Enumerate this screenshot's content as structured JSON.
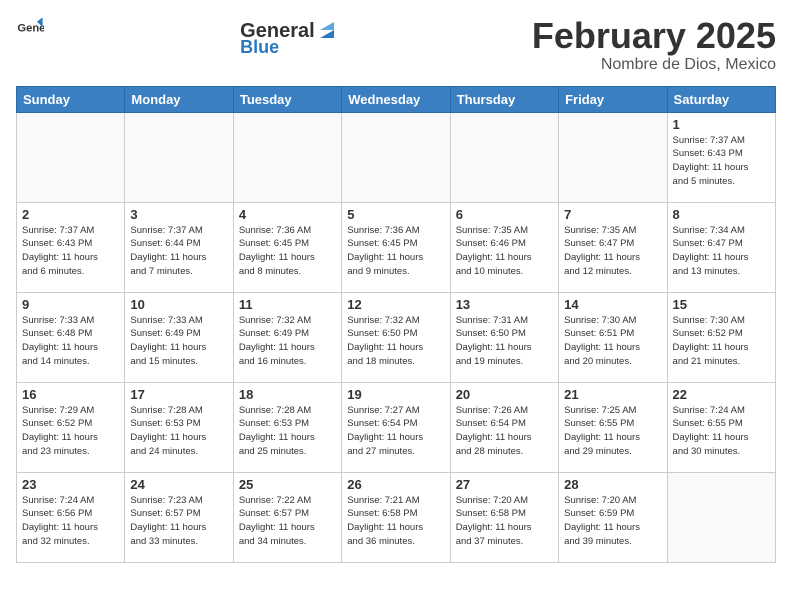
{
  "header": {
    "logo_general": "General",
    "logo_blue": "Blue",
    "month_title": "February 2025",
    "location": "Nombre de Dios, Mexico"
  },
  "weekdays": [
    "Sunday",
    "Monday",
    "Tuesday",
    "Wednesday",
    "Thursday",
    "Friday",
    "Saturday"
  ],
  "weeks": [
    [
      {
        "day": "",
        "info": ""
      },
      {
        "day": "",
        "info": ""
      },
      {
        "day": "",
        "info": ""
      },
      {
        "day": "",
        "info": ""
      },
      {
        "day": "",
        "info": ""
      },
      {
        "day": "",
        "info": ""
      },
      {
        "day": "1",
        "info": "Sunrise: 7:37 AM\nSunset: 6:43 PM\nDaylight: 11 hours\nand 5 minutes."
      }
    ],
    [
      {
        "day": "2",
        "info": "Sunrise: 7:37 AM\nSunset: 6:43 PM\nDaylight: 11 hours\nand 6 minutes."
      },
      {
        "day": "3",
        "info": "Sunrise: 7:37 AM\nSunset: 6:44 PM\nDaylight: 11 hours\nand 7 minutes."
      },
      {
        "day": "4",
        "info": "Sunrise: 7:36 AM\nSunset: 6:45 PM\nDaylight: 11 hours\nand 8 minutes."
      },
      {
        "day": "5",
        "info": "Sunrise: 7:36 AM\nSunset: 6:45 PM\nDaylight: 11 hours\nand 9 minutes."
      },
      {
        "day": "6",
        "info": "Sunrise: 7:35 AM\nSunset: 6:46 PM\nDaylight: 11 hours\nand 10 minutes."
      },
      {
        "day": "7",
        "info": "Sunrise: 7:35 AM\nSunset: 6:47 PM\nDaylight: 11 hours\nand 12 minutes."
      },
      {
        "day": "8",
        "info": "Sunrise: 7:34 AM\nSunset: 6:47 PM\nDaylight: 11 hours\nand 13 minutes."
      }
    ],
    [
      {
        "day": "9",
        "info": "Sunrise: 7:33 AM\nSunset: 6:48 PM\nDaylight: 11 hours\nand 14 minutes."
      },
      {
        "day": "10",
        "info": "Sunrise: 7:33 AM\nSunset: 6:49 PM\nDaylight: 11 hours\nand 15 minutes."
      },
      {
        "day": "11",
        "info": "Sunrise: 7:32 AM\nSunset: 6:49 PM\nDaylight: 11 hours\nand 16 minutes."
      },
      {
        "day": "12",
        "info": "Sunrise: 7:32 AM\nSunset: 6:50 PM\nDaylight: 11 hours\nand 18 minutes."
      },
      {
        "day": "13",
        "info": "Sunrise: 7:31 AM\nSunset: 6:50 PM\nDaylight: 11 hours\nand 19 minutes."
      },
      {
        "day": "14",
        "info": "Sunrise: 7:30 AM\nSunset: 6:51 PM\nDaylight: 11 hours\nand 20 minutes."
      },
      {
        "day": "15",
        "info": "Sunrise: 7:30 AM\nSunset: 6:52 PM\nDaylight: 11 hours\nand 21 minutes."
      }
    ],
    [
      {
        "day": "16",
        "info": "Sunrise: 7:29 AM\nSunset: 6:52 PM\nDaylight: 11 hours\nand 23 minutes."
      },
      {
        "day": "17",
        "info": "Sunrise: 7:28 AM\nSunset: 6:53 PM\nDaylight: 11 hours\nand 24 minutes."
      },
      {
        "day": "18",
        "info": "Sunrise: 7:28 AM\nSunset: 6:53 PM\nDaylight: 11 hours\nand 25 minutes."
      },
      {
        "day": "19",
        "info": "Sunrise: 7:27 AM\nSunset: 6:54 PM\nDaylight: 11 hours\nand 27 minutes."
      },
      {
        "day": "20",
        "info": "Sunrise: 7:26 AM\nSunset: 6:54 PM\nDaylight: 11 hours\nand 28 minutes."
      },
      {
        "day": "21",
        "info": "Sunrise: 7:25 AM\nSunset: 6:55 PM\nDaylight: 11 hours\nand 29 minutes."
      },
      {
        "day": "22",
        "info": "Sunrise: 7:24 AM\nSunset: 6:55 PM\nDaylight: 11 hours\nand 30 minutes."
      }
    ],
    [
      {
        "day": "23",
        "info": "Sunrise: 7:24 AM\nSunset: 6:56 PM\nDaylight: 11 hours\nand 32 minutes."
      },
      {
        "day": "24",
        "info": "Sunrise: 7:23 AM\nSunset: 6:57 PM\nDaylight: 11 hours\nand 33 minutes."
      },
      {
        "day": "25",
        "info": "Sunrise: 7:22 AM\nSunset: 6:57 PM\nDaylight: 11 hours\nand 34 minutes."
      },
      {
        "day": "26",
        "info": "Sunrise: 7:21 AM\nSunset: 6:58 PM\nDaylight: 11 hours\nand 36 minutes."
      },
      {
        "day": "27",
        "info": "Sunrise: 7:20 AM\nSunset: 6:58 PM\nDaylight: 11 hours\nand 37 minutes."
      },
      {
        "day": "28",
        "info": "Sunrise: 7:20 AM\nSunset: 6:59 PM\nDaylight: 11 hours\nand 39 minutes."
      },
      {
        "day": "",
        "info": ""
      }
    ]
  ]
}
